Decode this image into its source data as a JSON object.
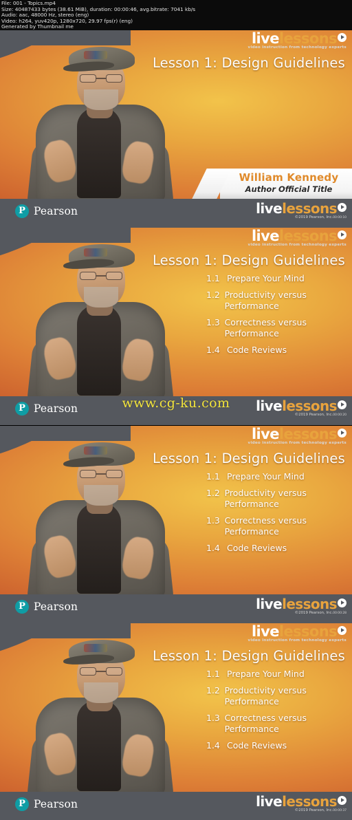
{
  "metadata": {
    "lines": [
      "File: 001 - Topics.mp4",
      "Size: 40487433 bytes (38.61 MiB), duration: 00:00:46, avg.bitrate: 7041 kb/s",
      "Audio: aac, 48000 Hz, stereo (eng)",
      "Video: h264, yuv420p, 1280x720, 29.97 fps(r) (eng)",
      "Generated by Thumbnail me"
    ],
    "file_name": "001 - Topics.mp4",
    "size_bytes": "40487433 bytes",
    "size_human": "38.61 MiB",
    "duration": "00:00:46",
    "avg_bitrate": "7041 kb/s",
    "audio_codec": "aac",
    "audio_sample_rate": "48000 Hz",
    "audio_channels": "stereo (eng)",
    "video_codec": "h264",
    "pixel_format": "yuv420p",
    "resolution": "1280x720",
    "frame_rate": "29.97 fps(r) (eng)",
    "generator": "Thumbnail me"
  },
  "watermark": "www.cg-ku.com",
  "colors": {
    "bar_gray": "#55585e",
    "accent_orange": "#e8a33d",
    "pearson_teal": "#0f9da5",
    "author_orange": "#e08a2a",
    "watermark_yellow": "#f2e43c",
    "header_bg": "#0b0b0b"
  },
  "brand": {
    "live_word": "live",
    "lessons_word": "lessons",
    "tagline": "video instruction from technology experts",
    "pearson_mark": "P",
    "pearson_name": "Pearson",
    "copyright": "©2019 Pearson, Inc."
  },
  "slide": {
    "title": "Lesson 1: Design Guidelines",
    "author_name": "William Kennedy",
    "author_title": "Author Official Title",
    "toc": [
      {
        "num": "1.1",
        "text": "Prepare Your Mind"
      },
      {
        "num": "1.2",
        "text": "Productivity versus Performance"
      },
      {
        "num": "1.3",
        "text": "Correctness versus Performance"
      },
      {
        "num": "1.4",
        "text": "Code Reviews"
      }
    ]
  },
  "frames": [
    {
      "index": 1,
      "timestamp": "00:00:10",
      "shows_toc": false,
      "shows_author": true
    },
    {
      "index": 2,
      "timestamp": "00:00:20",
      "shows_toc": true,
      "shows_author": false
    },
    {
      "index": 3,
      "timestamp": "00:00:28",
      "shows_toc": true,
      "shows_author": false
    },
    {
      "index": 4,
      "timestamp": "00:00:37",
      "shows_toc": true,
      "shows_author": false
    }
  ]
}
